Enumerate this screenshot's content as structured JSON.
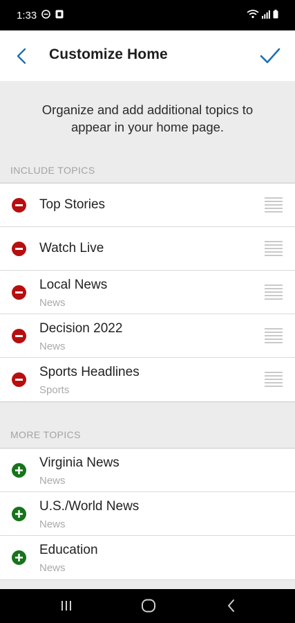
{
  "status_bar": {
    "time": "1:33"
  },
  "header": {
    "title": "Customize Home"
  },
  "intro": {
    "line1": "Organize and add additional topics to",
    "line2": "appear in your home page."
  },
  "include_section": {
    "label": "INCLUDE TOPICS",
    "items": [
      {
        "title": "Top Stories",
        "subtitle": ""
      },
      {
        "title": "Watch Live",
        "subtitle": ""
      },
      {
        "title": "Local News",
        "subtitle": "News"
      },
      {
        "title": "Decision 2022",
        "subtitle": "News"
      },
      {
        "title": "Sports Headlines",
        "subtitle": "Sports"
      }
    ]
  },
  "more_section": {
    "label": "MORE TOPICS",
    "items": [
      {
        "title": "Virginia News",
        "subtitle": "News"
      },
      {
        "title": "U.S./World News",
        "subtitle": "News"
      },
      {
        "title": "Education",
        "subtitle": "News"
      }
    ]
  },
  "icons": {
    "remove": "minus-circle-icon",
    "add": "plus-circle-icon",
    "drag": "drag-handle-icon",
    "back": "chevron-left-icon",
    "confirm": "checkmark-icon"
  },
  "colors": {
    "accent": "#1f6fb2",
    "remove": "#b70f0f",
    "add": "#17731c",
    "section_text": "#a3a3a3"
  }
}
